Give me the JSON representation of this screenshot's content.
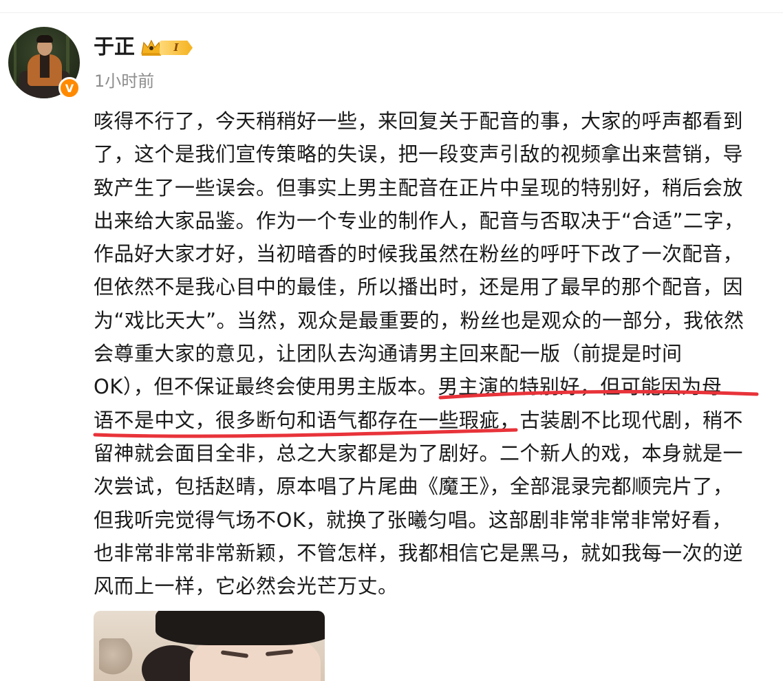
{
  "post": {
    "author": {
      "name": "于正",
      "vip_level": "I",
      "verified_mark": "V",
      "avatar_icon": "user-avatar-photo"
    },
    "timestamp": "1小时前",
    "body_lines": [
      "咳得不行了，今天稍稍好一些，来回复关于配音的事，大家的呼声都看到",
      "了，这个是我们宣传策略的失误，把一段变声引敌的视频拿出来营销，导",
      "致产生了一些误会。但事实上男主配音在正片中呈现的特别好，稍后会放",
      "出来给大家品鉴。作为一个专业的制作人，配音与否取决于“合适”二字，",
      "作品好大家才好，当初暗香的时候我虽然在粉丝的呼吁下改了一次配音，",
      "但依然不是我心目中的最佳，所以播出时，还是用了最早的那个配音，因",
      "为“戏比天大”。当然，观众是最重要的，粉丝也是观众的一部分，我依然",
      "会尊重大家的意见，让团队去沟通请男主回来配一版（前提是时间",
      "OK），但不保证最终会使用男主版本。男主演的特别好，但可能因为母",
      "语不是中文，很多断句和语气都存在一些瑕疵，古装剧不比现代剧，稍不",
      "留神就会面目全非，总之大家都是为了剧好。二个新人的戏，本身就是一",
      "次尝试，包括赵晴，原本唱了片尾曲《魔王》，全部混录完都顺完片了，",
      "但我听完觉得气场不OK，就换了张曦匀唱。这部剧非常非常非常好看，",
      "也非常非常非常新颖，不管怎样，我都相信它是黑马，就如我每一次的逆",
      "风而上一样，它必然会光芒万丈。"
    ],
    "highlight_color": "#e8333a",
    "accent_color": "#ff8a00"
  }
}
